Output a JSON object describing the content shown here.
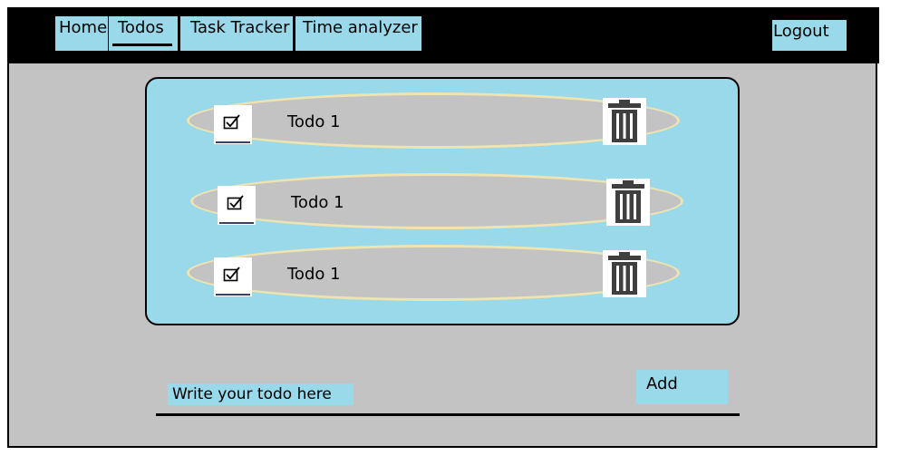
{
  "nav": {
    "tabs": [
      {
        "label": "Home"
      },
      {
        "label": "Todos"
      },
      {
        "label": "Task Tracker"
      },
      {
        "label": "Time analyzer"
      }
    ],
    "logout_label": "Logout"
  },
  "todos": [
    {
      "text": "Todo 1",
      "checkbox_icon": "checked-box-icon",
      "delete_icon": "trash-icon"
    },
    {
      "text": "Todo 1",
      "checkbox_icon": "checked-box-icon",
      "delete_icon": "trash-icon"
    },
    {
      "text": "Todo 1",
      "checkbox_icon": "checked-box-icon",
      "delete_icon": "trash-icon"
    }
  ],
  "composer": {
    "placeholder": "Write your todo here",
    "add_label": "Add"
  },
  "colors": {
    "accent": "#99d9ea",
    "background": "#c3c3c3",
    "navbar": "#000000",
    "item_border": "#efe4b0",
    "trash": "#3f3f3f"
  }
}
